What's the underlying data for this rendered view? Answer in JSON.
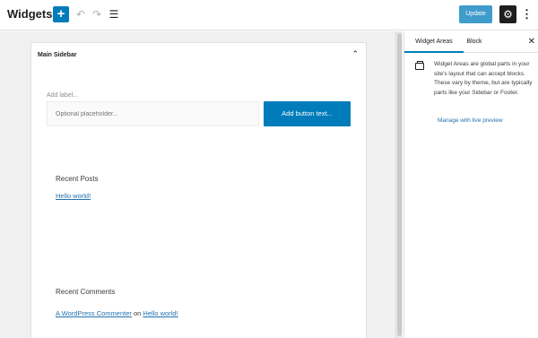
{
  "header": {
    "title": "Widgets",
    "update_label": "Update",
    "icons": {
      "add": "plus-icon",
      "undo": "undo-icon",
      "redo": "redo-icon",
      "list_view": "list-view-icon",
      "settings": "gear-icon",
      "more": "more-vertical-icon"
    },
    "colors": {
      "accent": "#007cba",
      "settings_bg": "#1e1e1e"
    }
  },
  "main": {
    "panel": {
      "title": "Main Sidebar",
      "search": {
        "label": "Add label...",
        "placeholder": "Optional placeholder...",
        "button_label": "Add button text..."
      },
      "recent_posts": {
        "title": "Recent Posts",
        "posts": [
          "Hello world!"
        ]
      },
      "recent_comments": {
        "title": "Recent Comments",
        "author": "A WordPress Commenter",
        "on": "on",
        "post": "Hello world!"
      }
    }
  },
  "sidebar": {
    "tabs": [
      {
        "label": "Widget Areas",
        "active": true
      },
      {
        "label": "Block",
        "active": false
      }
    ],
    "description": "Widget Areas are global parts in your site's layout that can accept blocks. These vary by theme, but are typically parts like your Sidebar or Footer.",
    "manage_link": "Manage with live preview"
  }
}
